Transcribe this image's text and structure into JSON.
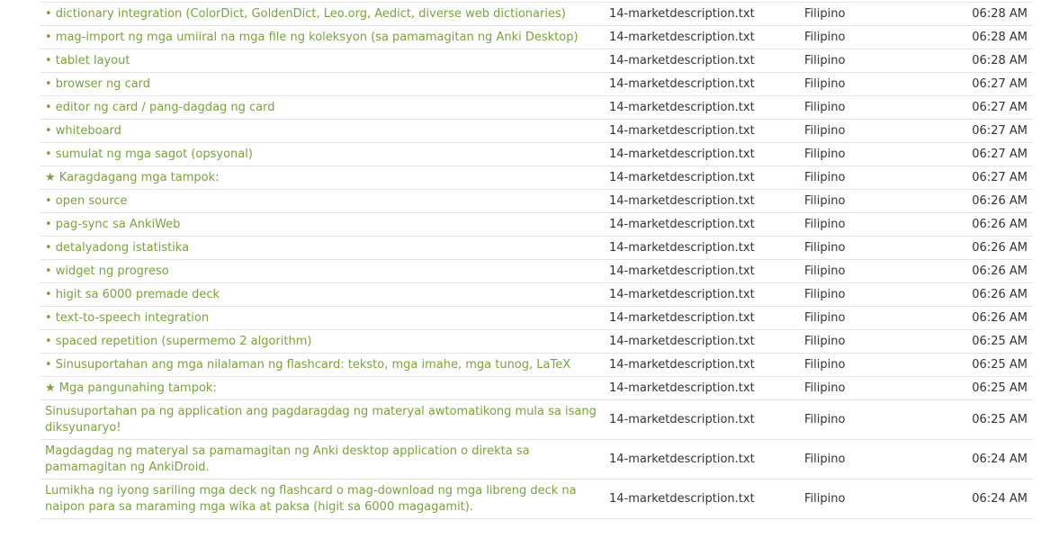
{
  "link_color": "#7aa23d",
  "rows": [
    {
      "text": "• dictionary integration (ColorDict, GoldenDict, Leo.org, Aedict, diverse web dictionaries)",
      "file": "14-marketdescription.txt",
      "lang": "Filipino",
      "time": "06:28 AM"
    },
    {
      "text": "• mag-import ng mga umiiral na mga file ng koleksyon (sa pamamagitan ng Anki Desktop)",
      "file": "14-marketdescription.txt",
      "lang": "Filipino",
      "time": "06:28 AM"
    },
    {
      "text": "• tablet layout",
      "file": "14-marketdescription.txt",
      "lang": "Filipino",
      "time": "06:28 AM"
    },
    {
      "text": "• browser ng card",
      "file": "14-marketdescription.txt",
      "lang": "Filipino",
      "time": "06:27 AM"
    },
    {
      "text": "• editor ng card / pang-dagdag ng card",
      "file": "14-marketdescription.txt",
      "lang": "Filipino",
      "time": "06:27 AM"
    },
    {
      "text": "• whiteboard",
      "file": "14-marketdescription.txt",
      "lang": "Filipino",
      "time": "06:27 AM"
    },
    {
      "text": "• sumulat ng mga sagot (opsyonal)",
      "file": "14-marketdescription.txt",
      "lang": "Filipino",
      "time": "06:27 AM"
    },
    {
      "text": "★ Karagdagang mga tampok:",
      "file": "14-marketdescription.txt",
      "lang": "Filipino",
      "time": "06:27 AM"
    },
    {
      "text": "• open source",
      "file": "14-marketdescription.txt",
      "lang": "Filipino",
      "time": "06:26 AM"
    },
    {
      "text": "• pag-sync sa AnkiWeb",
      "file": "14-marketdescription.txt",
      "lang": "Filipino",
      "time": "06:26 AM"
    },
    {
      "text": "• detalyadong istatistika",
      "file": "14-marketdescription.txt",
      "lang": "Filipino",
      "time": "06:26 AM"
    },
    {
      "text": "• widget ng progreso",
      "file": "14-marketdescription.txt",
      "lang": "Filipino",
      "time": "06:26 AM"
    },
    {
      "text": "• higit sa 6000 premade deck",
      "file": "14-marketdescription.txt",
      "lang": "Filipino",
      "time": "06:26 AM"
    },
    {
      "text": "• text-to-speech integration",
      "file": "14-marketdescription.txt",
      "lang": "Filipino",
      "time": "06:26 AM"
    },
    {
      "text": "• spaced repetition (supermemo 2 algorithm)",
      "file": "14-marketdescription.txt",
      "lang": "Filipino",
      "time": "06:25 AM"
    },
    {
      "text": "• Sinusuportahan ang mga nilalaman ng flashcard: teksto, mga imahe, mga tunog, LaTeX",
      "file": "14-marketdescription.txt",
      "lang": "Filipino",
      "time": "06:25 AM"
    },
    {
      "text": "★ Mga pangunahing tampok:",
      "file": "14-marketdescription.txt",
      "lang": "Filipino",
      "time": "06:25 AM"
    },
    {
      "text": "Sinusuportahan pa ng application ang pagdaragdag ng materyal awtomatikong mula sa isang diksyunaryo!",
      "file": "14-marketdescription.txt",
      "lang": "Filipino",
      "time": "06:25 AM"
    },
    {
      "text": "Magdagdag ng materyal sa pamamagitan ng Anki desktop application o direkta sa pamamagitan ng AnkiDroid.",
      "file": "14-marketdescription.txt",
      "lang": "Filipino",
      "time": "06:24 AM"
    },
    {
      "text": "Lumikha ng iyong sariling mga deck ng flashcard o mag-download ng mga libreng deck na naipon para sa maraming mga wika at paksa (higit sa 6000 magagamit).",
      "file": "14-marketdescription.txt",
      "lang": "Filipino",
      "time": "06:24 AM"
    }
  ]
}
